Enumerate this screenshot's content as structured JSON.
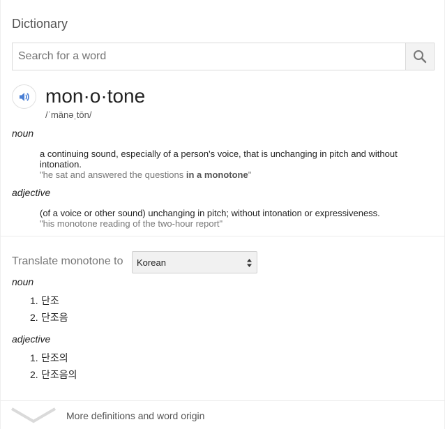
{
  "title": "Dictionary",
  "search": {
    "placeholder": "Search for a word",
    "value": ""
  },
  "entry": {
    "headword": "mon·o·tone",
    "phonetic": "/ˈmänəˌtōn/",
    "senses": [
      {
        "pos": "noun",
        "definition": "a continuing sound, especially of a person's voice, that is unchanging in pitch and without intonation.",
        "example_before": "\"he sat and answered the questions ",
        "example_bold": "in a monotone",
        "example_after": "\""
      },
      {
        "pos": "adjective",
        "definition": "(of a voice or other sound) unchanging in pitch; without intonation or expressiveness.",
        "example": "\"his monotone reading of the two-hour report\""
      }
    ]
  },
  "translate": {
    "label": "Translate monotone to",
    "language": "Korean",
    "groups": [
      {
        "pos": "noun",
        "items": [
          {
            "num": "1.",
            "text": "단조"
          },
          {
            "num": "2.",
            "text": "단조음"
          }
        ]
      },
      {
        "pos": "adjective",
        "items": [
          {
            "num": "1.",
            "text": "단조의"
          },
          {
            "num": "2.",
            "text": "단조음의"
          }
        ]
      }
    ]
  },
  "more": {
    "label": "More definitions and word origin"
  },
  "icons": {
    "search": "search-icon",
    "speaker": "speaker-icon",
    "select_arrows": "sort-arrows-icon",
    "expand": "chevron-down-icon"
  },
  "colors": {
    "speaker_blue": "#4a7fd4",
    "search_icon": "#777777"
  }
}
